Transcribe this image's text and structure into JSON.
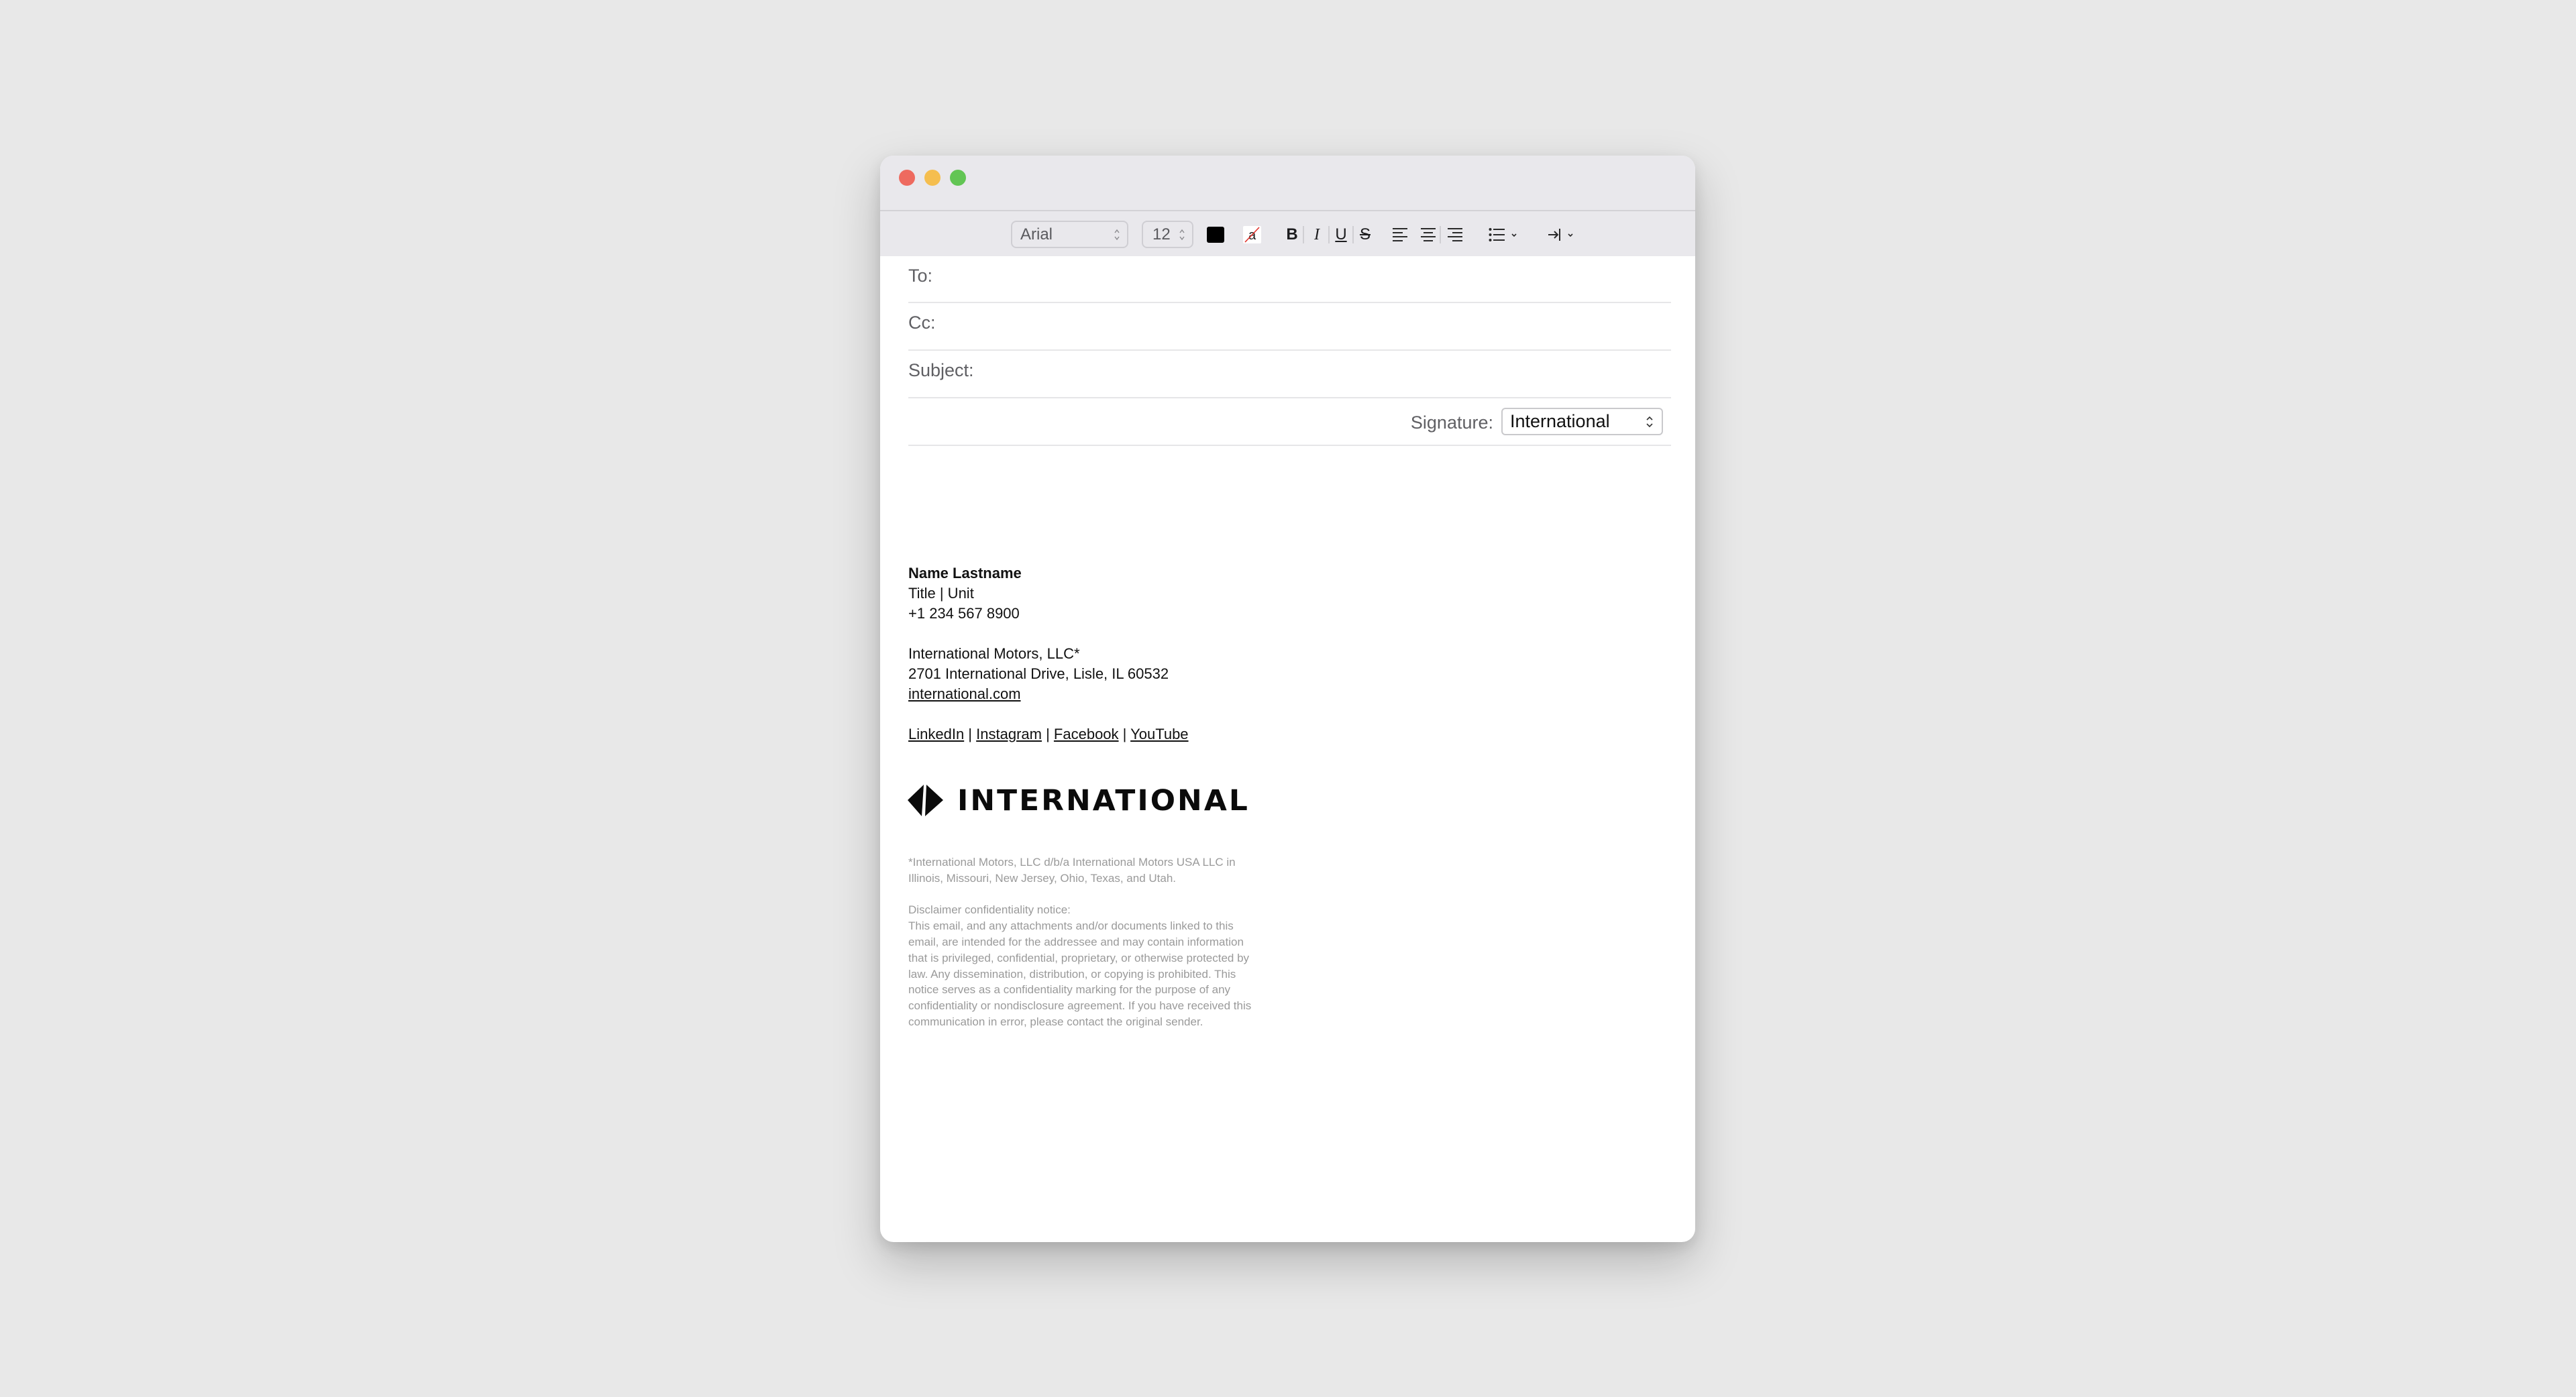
{
  "window": {
    "traffic_lights": [
      "close",
      "minimize",
      "maximize"
    ]
  },
  "toolbar": {
    "font_family": "Arial",
    "font_size": "12",
    "text_color": "#000000",
    "highlight_glyph": "a",
    "bold": "B",
    "italic": "I",
    "underline": "U",
    "strikethrough": "S",
    "icons": [
      "align-left-icon",
      "align-center-icon",
      "align-right-icon",
      "list-icon",
      "indent-icon"
    ]
  },
  "fields": {
    "to_label": "To:",
    "cc_label": "Cc:",
    "subject_label": "Subject:",
    "to_value": "",
    "cc_value": "",
    "subject_value": "",
    "signature_label": "Signature:",
    "signature_value": "International"
  },
  "signature": {
    "name": "Name Lastname",
    "title": "Title | Unit",
    "phone": "+1 234 567 8900",
    "company": "International Motors, LLC*",
    "address": "2701 International Drive, Lisle, IL 60532",
    "website": "international.com",
    "social": [
      {
        "label": "LinkedIn"
      },
      {
        "label": "Instagram"
      },
      {
        "label": "Facebook"
      },
      {
        "label": "YouTube"
      }
    ],
    "separator": " | ",
    "logo_text": "INTERNATIONAL"
  },
  "disclaimer": {
    "footnote_lines": [
      "*International Motors, LLC d/b/a International Motors USA LLC in",
      "Illinois, Missouri, New Jersey, Ohio, Texas, and Utah."
    ],
    "heading": "Disclaimer confidentiality notice:",
    "body_lines": [
      "This email, and any attachments and/or documents linked to this",
      "email, are intended for the addressee and may contain information",
      "that is privileged, confidential, proprietary, or otherwise protected by",
      "law. Any dissemination, distribution, or copying is prohibited. This",
      "notice serves as a confidentiality marking for the purpose of any",
      "confidentiality or nondisclosure agreement. If you have received this",
      "communication in error, please contact the original sender."
    ]
  }
}
